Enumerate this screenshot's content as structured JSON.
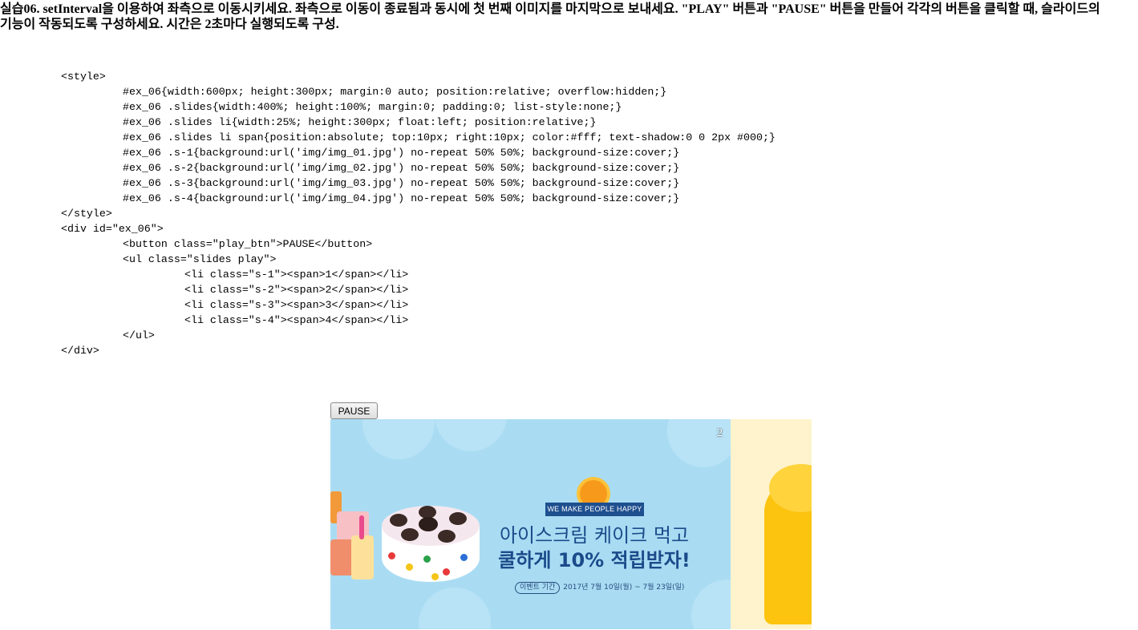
{
  "task": {
    "text": "실습06. setInterval을 이용하여 좌측으로 이동시키세요. 좌측으로 이동이 종료됨과 동시에 첫 번째 이미지를 마지막으로 보내세요. \"PLAY\" 버튼과 \"PAUSE\" 버튼을 만들어 각각의 버튼을 클릭할 때, 슬라이드의 기능이 작동되도록 구성하세요. 시간은 2초마다 실행되도록 구성."
  },
  "code_lines": [
    "<style>",
    "#ex_06{width:600px; height:300px; margin:0 auto; position:relative; overflow:hidden;}",
    "#ex_06 .slides{width:400%; height:100%; margin:0; padding:0; list-style:none;}",
    "#ex_06 .slides li{width:25%; height:300px; float:left; position:relative;}",
    "#ex_06 .slides li span{position:absolute; top:10px; right:10px; color:#fff; text-shadow:0 0 2px #000;}",
    "#ex_06 .s-1{background:url('img/img_01.jpg') no-repeat 50% 50%; background-size:cover;}",
    "#ex_06 .s-2{background:url('img/img_02.jpg') no-repeat 50% 50%; background-size:cover;}",
    "#ex_06 .s-3{background:url('img/img_03.jpg') no-repeat 50% 50%; background-size:cover;}",
    "#ex_06 .s-4{background:url('img/img_04.jpg') no-repeat 50% 50%; background-size:cover;}",
    "</style>",
    "<div id=\"ex_06\">",
    "<button class=\"play_btn\">PAUSE</button>",
    "<ul class=\"slides play\">",
    "<li class=\"s-1\"><span>1</span></li>",
    "<li class=\"s-2\"><span>2</span></li>",
    "<li class=\"s-3\"><span>3</span></li>",
    "<li class=\"s-4\"><span>4</span></li>",
    "</ul>",
    "</div>"
  ],
  "slider": {
    "button_label": "PAUSE",
    "current_slide_number": "2",
    "banner": {
      "tag": "WE MAKE PEOPLE HAPPY",
      "headline_line1": "아이스크림 케이크 먹고",
      "headline_line2": "쿨하게 10% 적립받자!",
      "period_pill": "이벤트 기간",
      "period_text": "2017년 7월 10일(월) ~ 7월 23일(일)"
    },
    "colors": {
      "slide_bg": "#a9dcf3",
      "next_slide_bg": "#fef3cc",
      "headline": "#1b4b8a",
      "tag_bg": "#1e4f8f"
    }
  }
}
